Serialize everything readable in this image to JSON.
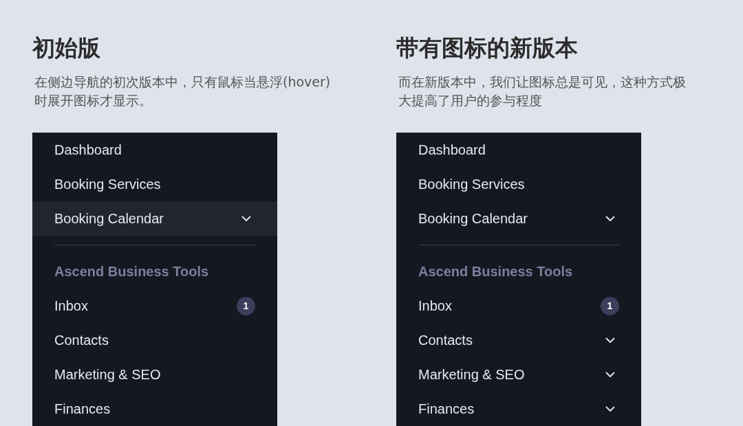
{
  "panels": [
    {
      "title": "初始版",
      "description": "在侧边导航的初次版本中，只有鼠标当悬浮(hover)时展开图标才显示。",
      "nav": [
        {
          "kind": "item",
          "label": "Dashboard",
          "hovered": false
        },
        {
          "kind": "item",
          "label": "Booking Services",
          "hovered": false
        },
        {
          "kind": "item",
          "label": "Booking Calendar",
          "hovered": true,
          "chevron": true
        },
        {
          "kind": "divider"
        },
        {
          "kind": "section",
          "label": "Ascend Business Tools"
        },
        {
          "kind": "item",
          "label": "Inbox",
          "hovered": false,
          "badge": "1"
        },
        {
          "kind": "item",
          "label": "Contacts",
          "hovered": false
        },
        {
          "kind": "item",
          "label": "Marketing & SEO",
          "hovered": false
        },
        {
          "kind": "item",
          "label": "Finances",
          "hovered": false
        }
      ]
    },
    {
      "title": "带有图标的新版本",
      "description": "而在新版本中，我们让图标总是可见，这种方式极大提高了用户的参与程度",
      "nav": [
        {
          "kind": "item",
          "label": "Dashboard",
          "hovered": false
        },
        {
          "kind": "item",
          "label": "Booking Services",
          "hovered": false
        },
        {
          "kind": "item",
          "label": "Booking Calendar",
          "hovered": false,
          "chevron": true
        },
        {
          "kind": "divider"
        },
        {
          "kind": "section",
          "label": "Ascend Business Tools"
        },
        {
          "kind": "item",
          "label": "Inbox",
          "hovered": false,
          "badge": "1"
        },
        {
          "kind": "item",
          "label": "Contacts",
          "hovered": false,
          "chevron": true
        },
        {
          "kind": "item",
          "label": "Marketing & SEO",
          "hovered": false,
          "chevron": true
        },
        {
          "kind": "item",
          "label": "Finances",
          "hovered": false,
          "chevron": true
        }
      ]
    }
  ]
}
